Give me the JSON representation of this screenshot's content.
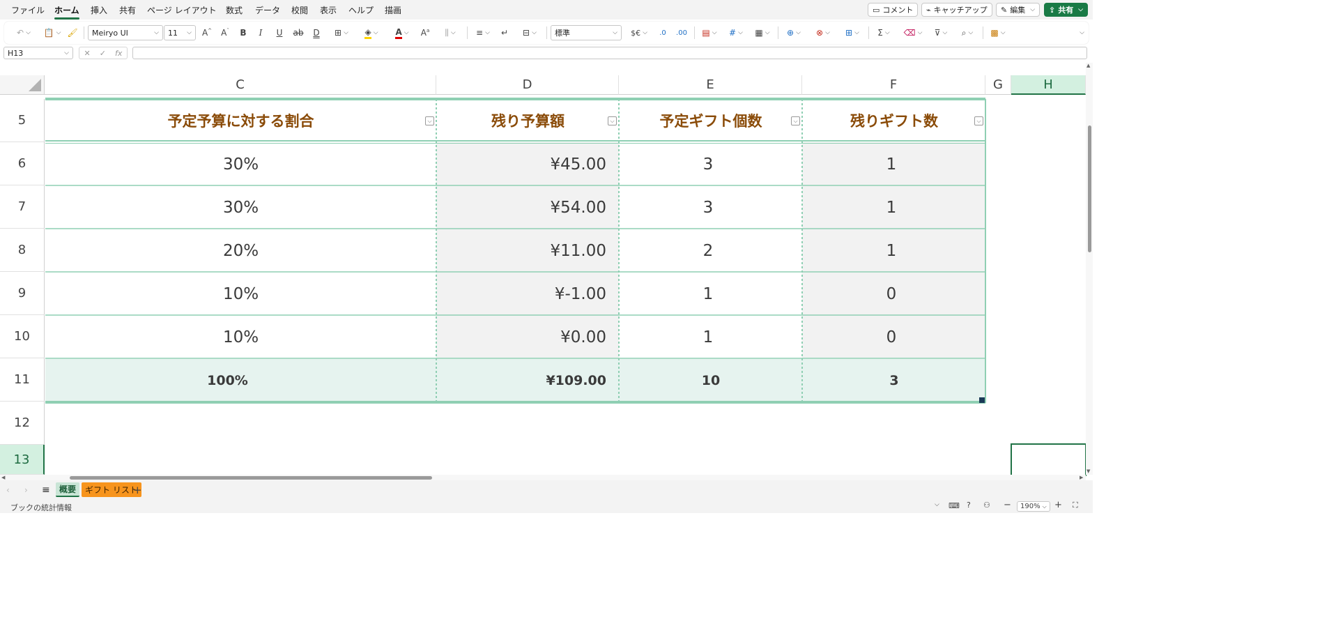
{
  "menu": {
    "tabs": [
      "ファイル",
      "ホーム",
      "挿入",
      "共有",
      "ページ レイアウト",
      "数式",
      "データ",
      "校閲",
      "表示",
      "ヘルプ",
      "描画"
    ],
    "active_tab": "ホーム",
    "comment_label": "コメント",
    "catchup_label": "キャッチアップ",
    "edit_label": "編集",
    "share_label": "共有"
  },
  "toolbar": {
    "font_name": "Meiryo UI",
    "font_size": "11",
    "number_format": "標準",
    "currency_symbol": "$€"
  },
  "formula_bar": {
    "cell_ref": "H13",
    "formula": ""
  },
  "grid": {
    "columns": [
      "C",
      "D",
      "E",
      "F",
      "G",
      "H"
    ],
    "selected_column": "H",
    "rows": [
      "5",
      "6",
      "7",
      "8",
      "9",
      "10",
      "11",
      "12",
      "13"
    ],
    "selected_row": "13",
    "headers": [
      "予定予算に対する割合",
      "残り予算額",
      "予定ギフト個数",
      "残りギフト数"
    ],
    "data": [
      [
        "30%",
        "¥45.00",
        "3",
        "1"
      ],
      [
        "30%",
        "¥54.00",
        "3",
        "1"
      ],
      [
        "20%",
        "¥11.00",
        "2",
        "1"
      ],
      [
        "10%",
        "¥-1.00",
        "1",
        "0"
      ],
      [
        "10%",
        "¥0.00",
        "1",
        "0"
      ]
    ],
    "totals": [
      "100%",
      "¥109.00",
      "10",
      "3"
    ]
  },
  "sheets": {
    "tabs": [
      "概要",
      "ギフト リスト"
    ],
    "active": "概要"
  },
  "status": {
    "left_text": "ブックの統計情報",
    "zoom": "190%"
  },
  "colors": {
    "accent": "#217346",
    "table_border": "#8fcfb3",
    "header_text": "#8a4b08",
    "total_fill": "#e6f3ef",
    "col_d_fill": "#f2f2f2",
    "sheet2_tab": "#f7941d"
  }
}
